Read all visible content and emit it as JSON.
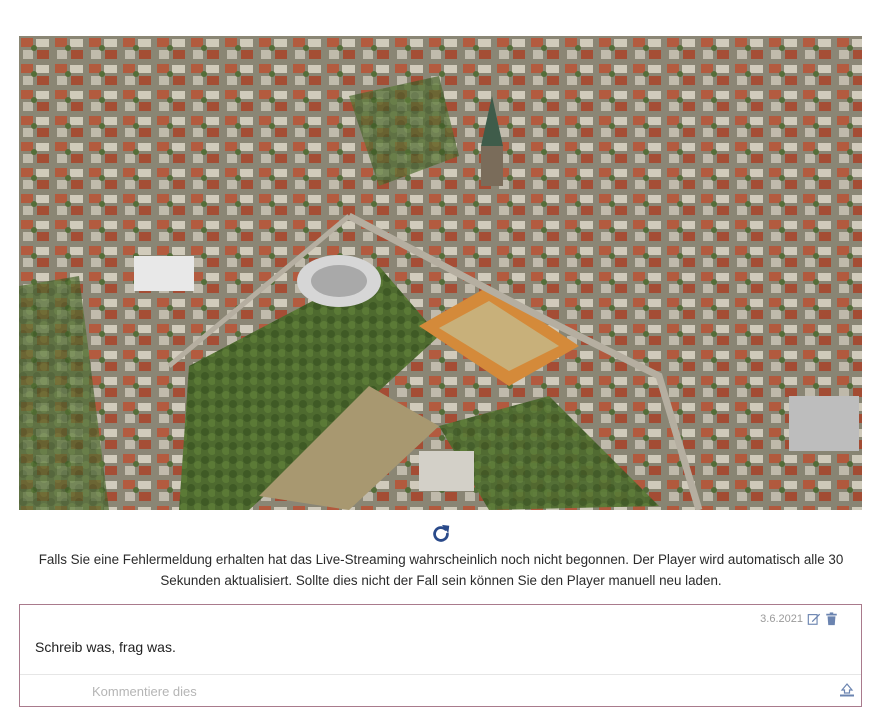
{
  "stream": {
    "icon": "aerial-city-image"
  },
  "reload": {
    "icon": "reload-icon",
    "color": "#2a4a8a"
  },
  "notice": {
    "text": "Falls Sie eine Fehlermeldung erhalten hat das Live-Streaming wahrscheinlich noch nicht begonnen. Der Player wird automatisch alle 30 Sekunden aktualisiert. Sollte dies nicht der Fall sein können Sie den Player manuell neu laden."
  },
  "comment": {
    "date": "3.6.2021",
    "edit_icon": "edit-icon",
    "delete_icon": "trash-icon",
    "text": "Schreib was, frag was.",
    "border_color": "#a97a8c"
  },
  "reply": {
    "placeholder": "Kommentiere dies",
    "send_icon": "send-icon"
  }
}
